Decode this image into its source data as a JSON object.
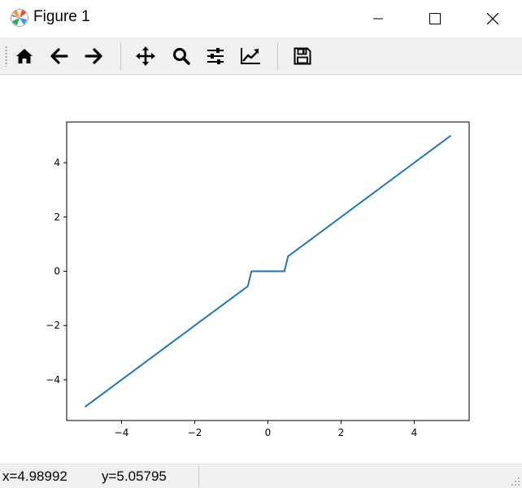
{
  "window": {
    "title": "Figure 1",
    "icon": "matplotlib-logo-icon"
  },
  "toolbar": {
    "buttons": [
      {
        "name": "home",
        "icon": "home-icon"
      },
      {
        "name": "back",
        "icon": "arrow-left-icon"
      },
      {
        "name": "forward",
        "icon": "arrow-right-icon"
      },
      {
        "name": "pan",
        "icon": "move-icon"
      },
      {
        "name": "zoom",
        "icon": "zoom-icon"
      },
      {
        "name": "subplots",
        "icon": "sliders-icon"
      },
      {
        "name": "edit-axes",
        "icon": "trend-chart-icon"
      },
      {
        "name": "save",
        "icon": "floppy-disk-icon"
      }
    ]
  },
  "status": {
    "x_readout": "x=4.98992",
    "y_readout": "y=5.05795"
  },
  "colors": {
    "line": "#1f77b4",
    "toolbar_bg": "#f0f0f0",
    "axes_edge": "#000000"
  },
  "chart_data": {
    "type": "line",
    "title": "",
    "xlabel": "",
    "ylabel": "",
    "xlim": [
      -5.5,
      5.5
    ],
    "ylim": [
      -5.5,
      5.5
    ],
    "xticks": [
      -4,
      -2,
      0,
      2,
      4
    ],
    "yticks": [
      -4,
      -2,
      0,
      2,
      4
    ],
    "xtick_labels": [
      "−4",
      "−2",
      "0",
      "2",
      "4"
    ],
    "ytick_labels": [
      "−4",
      "−2",
      "0",
      "2",
      "4"
    ],
    "grid": false,
    "series": [
      {
        "x": [
          -5.0,
          -0.55,
          -0.45,
          0.45,
          0.55,
          5.0
        ],
        "y": [
          -5.0,
          -0.55,
          0.0,
          0.0,
          0.55,
          5.0
        ]
      }
    ]
  }
}
